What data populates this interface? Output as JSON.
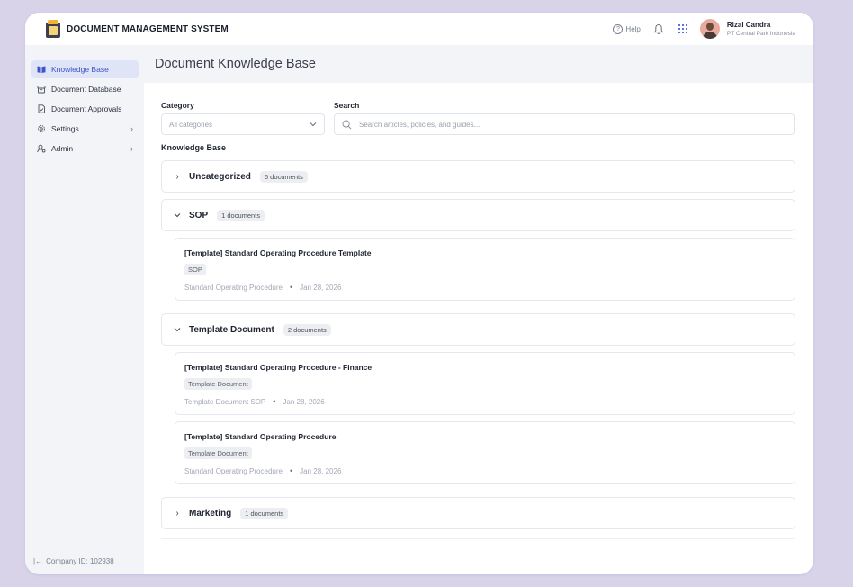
{
  "app": {
    "title": "DOCUMENT MANAGEMENT SYSTEM"
  },
  "topbar": {
    "help_label": "Help",
    "user_name": "Rizal Candra",
    "user_org": "PT Central Park Indonesia"
  },
  "sidebar": {
    "items": [
      {
        "label": "Knowledge Base",
        "icon": "book-icon",
        "active": true
      },
      {
        "label": "Document Database",
        "icon": "database-icon"
      },
      {
        "label": "Document Approvals",
        "icon": "approval-icon"
      },
      {
        "label": "Settings",
        "icon": "gear-icon"
      },
      {
        "label": "Admin",
        "icon": "admin-icon"
      }
    ],
    "company_id": "Company ID: 102938"
  },
  "page": {
    "title": "Document Knowledge Base"
  },
  "filters": {
    "category_label": "Category",
    "category_value": "All categories",
    "search_label": "Search",
    "search_placeholder": "Search articles, policies, and guides..."
  },
  "kb": {
    "title": "Knowledge Base",
    "groups": [
      {
        "name": "Uncategorized",
        "count": "6 documents",
        "expanded": false
      },
      {
        "name": "SOP",
        "count": "1 documents",
        "expanded": true,
        "docs": [
          {
            "title": "[Template] Standard Operating Procedure Template",
            "tag": "SOP",
            "meta": "Standard Operating Procedure",
            "date": "Jan 28, 2026"
          }
        ]
      },
      {
        "name": "Template Document",
        "count": "2 documents",
        "expanded": true,
        "docs": [
          {
            "title": "[Template] Standard Operating Procedure - Finance",
            "tag": "Template Document",
            "meta": "Template Document SOP",
            "date": "Jan 28, 2026"
          },
          {
            "title": "[Template] Standard Operating Procedure",
            "tag": "Template Document",
            "meta": "Standard Operating Procedure",
            "date": "Jan 28, 2026"
          }
        ]
      },
      {
        "name": "Marketing",
        "count": "1 documents",
        "expanded": false
      }
    ]
  },
  "colors": {
    "accent": "#3c55c9",
    "active_bg": "#dfe4f7",
    "page_bg": "#d9d3ea"
  }
}
